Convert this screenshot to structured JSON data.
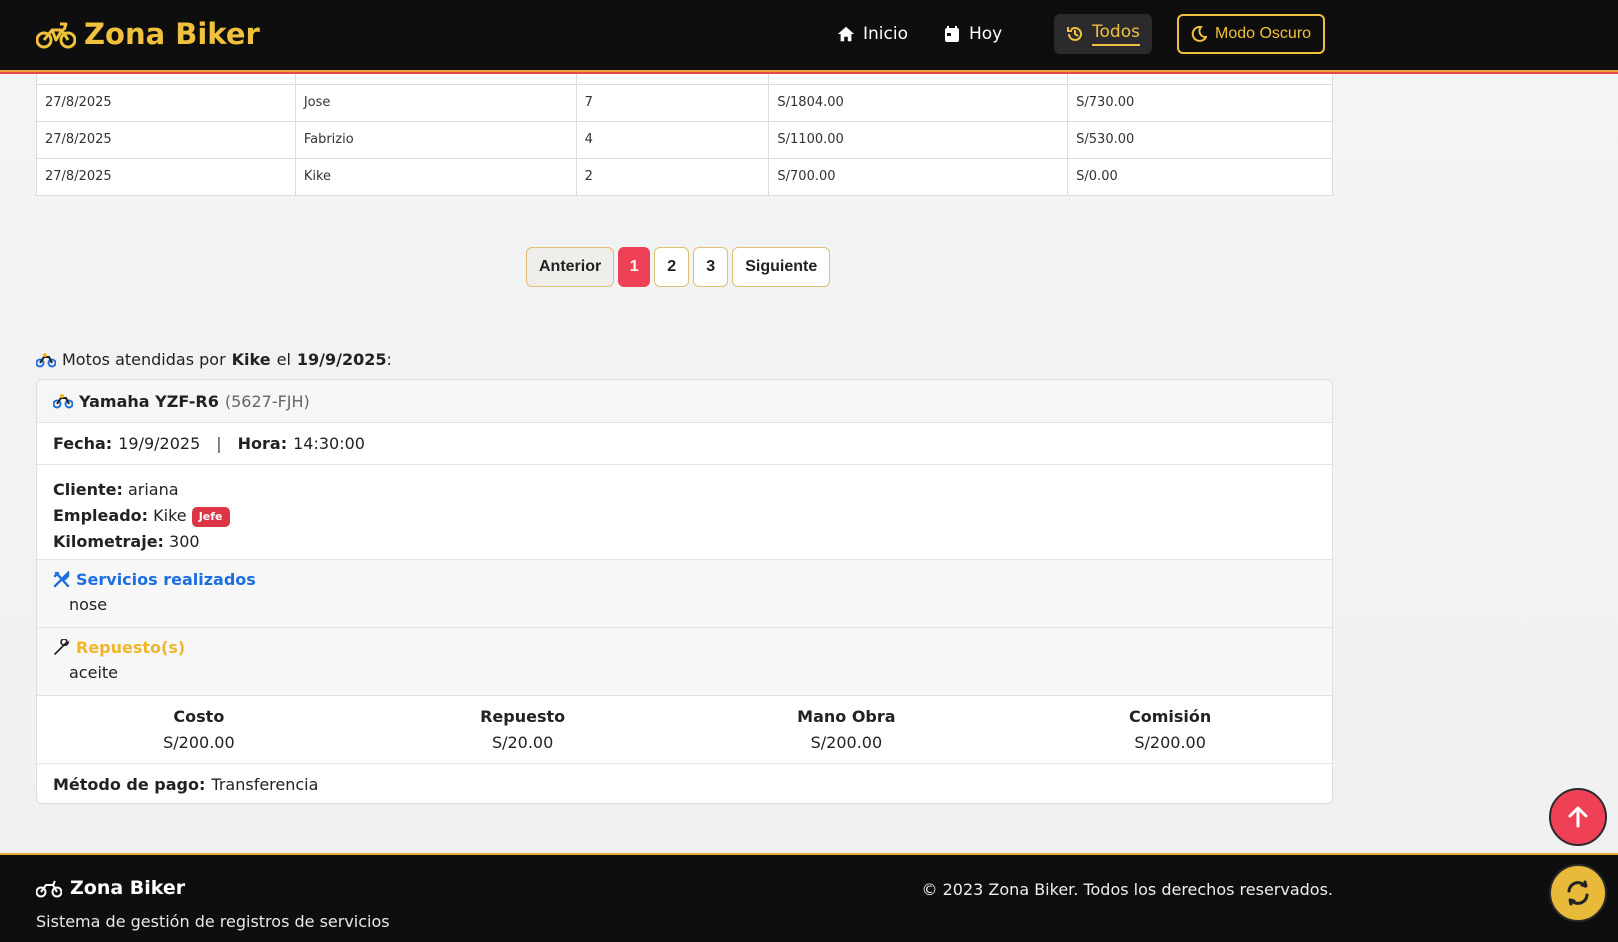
{
  "header": {
    "brand": "Zona Biker",
    "nav": {
      "inicio": "Inicio",
      "hoy": "Hoy",
      "todos": "Todos",
      "dark_mode": "Modo Oscuro"
    },
    "accent_color": "#f0c13c"
  },
  "table": {
    "rows": [
      [
        "27/8/2025",
        "Jose",
        "7",
        "S/1804.00",
        "S/730.00"
      ],
      [
        "27/8/2025",
        "Fabrizio",
        "4",
        "S/1100.00",
        "S/530.00"
      ],
      [
        "27/8/2025",
        "Kike",
        "2",
        "S/700.00",
        "S/0.00"
      ]
    ]
  },
  "pagination": {
    "prev": "Anterior",
    "pages": [
      "1",
      "2",
      "3"
    ],
    "current": "1",
    "next": "Siguiente"
  },
  "motos": {
    "title_prefix": "Motos atendidas por",
    "employee": "Kike",
    "connector": "el",
    "date": "19/9/2025",
    "title_suffix": ":",
    "card": {
      "model": "Yamaha YZF-R6",
      "plate": "(5627-FJH)",
      "fecha_label": "Fecha:",
      "fecha": "19/9/2025",
      "separator": "|",
      "hora_label": "Hora:",
      "hora": "14:30:00",
      "cliente_label": "Cliente:",
      "cliente": "ariana",
      "empleado_label": "Empleado:",
      "empleado": "Kike",
      "role_badge": "Jefe",
      "km_label": "Kilometraje:",
      "km": "300",
      "servicios_label": "Servicios realizados",
      "servicios": "nose",
      "repuestos_label": "Repuesto(s)",
      "repuestos": "aceite",
      "costs": [
        {
          "label": "Costo",
          "value": "S/200.00"
        },
        {
          "label": "Repuesto",
          "value": "S/20.00"
        },
        {
          "label": "Mano Obra",
          "value": "S/200.00"
        },
        {
          "label": "Comisión",
          "value": "S/200.00"
        }
      ],
      "pago_label": "Método de pago:",
      "pago": "Transferencia"
    }
  },
  "footer": {
    "brand": "Zona Biker",
    "subtitle": "Sistema de gestión de registros de servicios",
    "copyright": "© 2023 Zona Biker. Todos los derechos reservados."
  },
  "icons": {
    "brand": "motorcycle-icon",
    "inicio": "home-icon",
    "hoy": "calendar-icon",
    "todos": "history-icon",
    "dark_mode": "moon-icon",
    "servicios": "tools-icon",
    "repuestos": "wrench-icon",
    "scroll_top": "arrow-up-icon",
    "refresh": "refresh-icon"
  }
}
